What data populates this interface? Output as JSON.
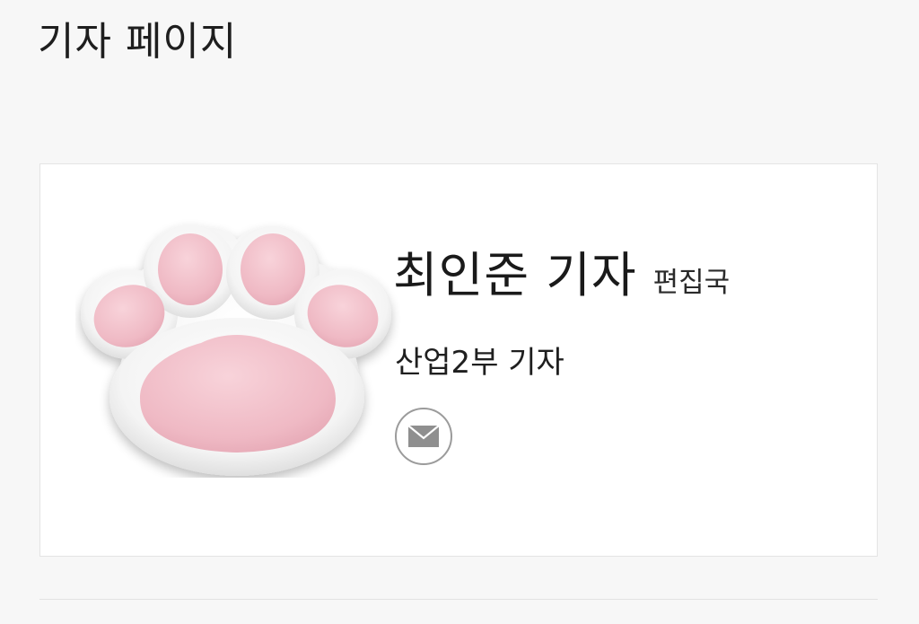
{
  "header": {
    "title": "기자 페이지"
  },
  "reporter": {
    "name": "최인준 기자",
    "department": "편집국",
    "position": "산업2부 기자",
    "avatar_icon": "cat-paw-icon",
    "email_icon": "mail-icon"
  },
  "colors": {
    "background": "#f7f7f7",
    "card": "#ffffff",
    "paw_pad": "#f1c3cd",
    "paw_base": "#ffffff",
    "email_border": "#9b9b9b",
    "email_icon": "#8f8f8f"
  }
}
